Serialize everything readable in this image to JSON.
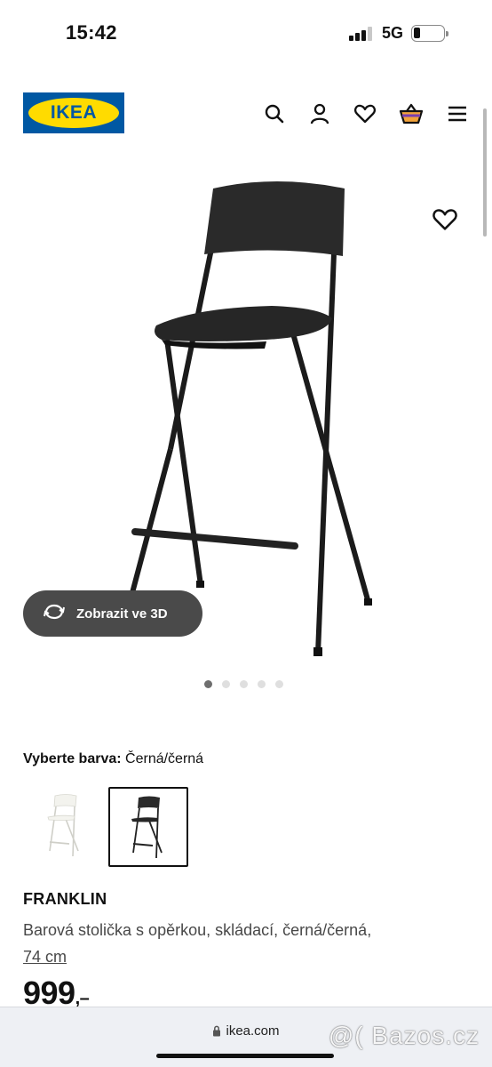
{
  "status_bar": {
    "time": "15:42",
    "network": "5G"
  },
  "header": {
    "logo_text": "IKEA",
    "icons": [
      "search-icon",
      "profile-icon",
      "favorite-icon",
      "cart-icon",
      "menu-icon"
    ]
  },
  "gallery": {
    "view_3d_label": "Zobrazit ve 3D",
    "image_count": 5,
    "active_image": 1
  },
  "color_picker": {
    "label": "Vyberte barva:",
    "selected_value": "Černá/černá",
    "options": [
      "white",
      "black"
    ],
    "selected_index": 1
  },
  "product": {
    "name": "FRANKLIN",
    "description": "Barová stolička s opěrkou, skládací, černá/černá,",
    "size_link": "74 cm",
    "price": "999",
    "price_suffix": ",–"
  },
  "browser": {
    "url": "ikea.com",
    "watermark": "@( Bazos.cz"
  },
  "colors": {
    "ikea_blue": "#0058a3",
    "ikea_yellow": "#ffdb00",
    "button_dark": "#4a4a4a"
  }
}
